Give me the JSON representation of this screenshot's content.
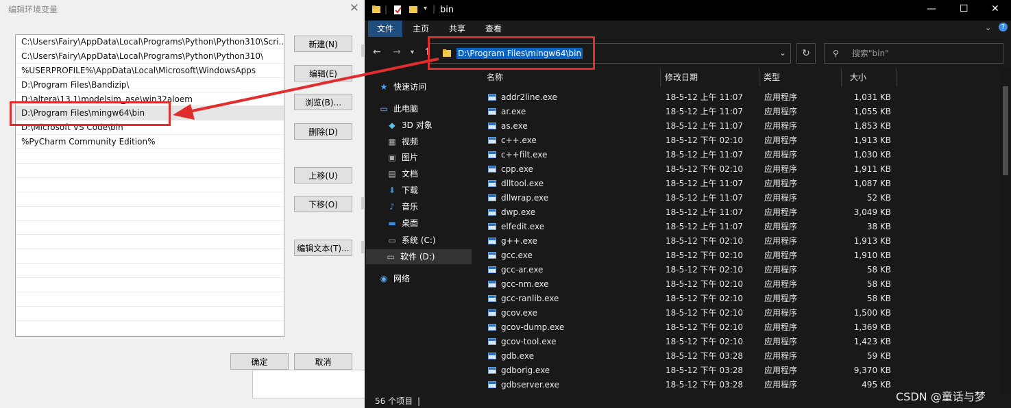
{
  "dialog": {
    "title": "编辑环境变量",
    "close": "✕",
    "paths": [
      "C:\\Users\\Fairy\\AppData\\Local\\Programs\\Python\\Python310\\Scri...",
      "C:\\Users\\Fairy\\AppData\\Local\\Programs\\Python\\Python310\\",
      "%USERPROFILE%\\AppData\\Local\\Microsoft\\WindowsApps",
      "D:\\Program Files\\Bandizip\\",
      "D:\\altera\\13.1\\modelsim_ase\\win32aloem",
      "D:\\Program Files\\mingw64\\bin",
      "D:\\Microsoft VS Code\\bin",
      "%PyCharm Community Edition%"
    ],
    "buttons": {
      "new": "新建(N)",
      "edit": "编辑(E)",
      "browse": "浏览(B)...",
      "delete": "删除(D)",
      "move_up": "上移(U)",
      "move_down": "下移(O)",
      "edit_text": "编辑文本(T)...",
      "ok": "确定",
      "cancel": "取消"
    }
  },
  "explorer": {
    "title": "bin",
    "ribbon_tabs": [
      "文件",
      "主页",
      "共享",
      "查看"
    ],
    "address": "D:\\Program Files\\mingw64\\bin",
    "search_placeholder": "搜索\"bin\"",
    "nav": {
      "quick_access": "快速访问",
      "this_pc": "此电脑",
      "objects_3d": "3D 对象",
      "videos": "视频",
      "pictures": "图片",
      "documents": "文档",
      "downloads": "下载",
      "music": "音乐",
      "desktop": "桌面",
      "drive_c": "系统 (C:)",
      "drive_d": "软件 (D:)",
      "network": "网络"
    },
    "columns": {
      "name": "名称",
      "date": "修改日期",
      "type": "类型",
      "size": "大小"
    },
    "files": [
      {
        "name": "addr2line.exe",
        "date": "18-5-12 上午 11:07",
        "type": "应用程序",
        "size": "1,031 KB"
      },
      {
        "name": "ar.exe",
        "date": "18-5-12 上午 11:07",
        "type": "应用程序",
        "size": "1,055 KB"
      },
      {
        "name": "as.exe",
        "date": "18-5-12 上午 11:07",
        "type": "应用程序",
        "size": "1,853 KB"
      },
      {
        "name": "c++.exe",
        "date": "18-5-12 下午 02:10",
        "type": "应用程序",
        "size": "1,913 KB"
      },
      {
        "name": "c++filt.exe",
        "date": "18-5-12 上午 11:07",
        "type": "应用程序",
        "size": "1,030 KB"
      },
      {
        "name": "cpp.exe",
        "date": "18-5-12 下午 02:10",
        "type": "应用程序",
        "size": "1,911 KB"
      },
      {
        "name": "dlltool.exe",
        "date": "18-5-12 上午 11:07",
        "type": "应用程序",
        "size": "1,087 KB"
      },
      {
        "name": "dllwrap.exe",
        "date": "18-5-12 上午 11:07",
        "type": "应用程序",
        "size": "52 KB"
      },
      {
        "name": "dwp.exe",
        "date": "18-5-12 上午 11:07",
        "type": "应用程序",
        "size": "3,049 KB"
      },
      {
        "name": "elfedit.exe",
        "date": "18-5-12 上午 11:07",
        "type": "应用程序",
        "size": "38 KB"
      },
      {
        "name": "g++.exe",
        "date": "18-5-12 下午 02:10",
        "type": "应用程序",
        "size": "1,913 KB"
      },
      {
        "name": "gcc.exe",
        "date": "18-5-12 下午 02:10",
        "type": "应用程序",
        "size": "1,910 KB"
      },
      {
        "name": "gcc-ar.exe",
        "date": "18-5-12 下午 02:10",
        "type": "应用程序",
        "size": "58 KB"
      },
      {
        "name": "gcc-nm.exe",
        "date": "18-5-12 下午 02:10",
        "type": "应用程序",
        "size": "58 KB"
      },
      {
        "name": "gcc-ranlib.exe",
        "date": "18-5-12 下午 02:10",
        "type": "应用程序",
        "size": "58 KB"
      },
      {
        "name": "gcov.exe",
        "date": "18-5-12 下午 02:10",
        "type": "应用程序",
        "size": "1,500 KB"
      },
      {
        "name": "gcov-dump.exe",
        "date": "18-5-12 下午 02:10",
        "type": "应用程序",
        "size": "1,369 KB"
      },
      {
        "name": "gcov-tool.exe",
        "date": "18-5-12 下午 02:10",
        "type": "应用程序",
        "size": "1,423 KB"
      },
      {
        "name": "gdb.exe",
        "date": "18-5-12 下午 03:28",
        "type": "应用程序",
        "size": "59 KB"
      },
      {
        "name": "gdborig.exe",
        "date": "18-5-12 下午 03:28",
        "type": "应用程序",
        "size": "9,370 KB"
      },
      {
        "name": "gdbserver.exe",
        "date": "18-5-12 下午 03:28",
        "type": "应用程序",
        "size": "495 KB"
      }
    ],
    "status": "56 个项目"
  },
  "watermark": "CSDN @童话与梦",
  "colors": {
    "annotation_red": "#e02e2e",
    "selection_blue": "#0b63c4",
    "explorer_bg": "#191919"
  }
}
